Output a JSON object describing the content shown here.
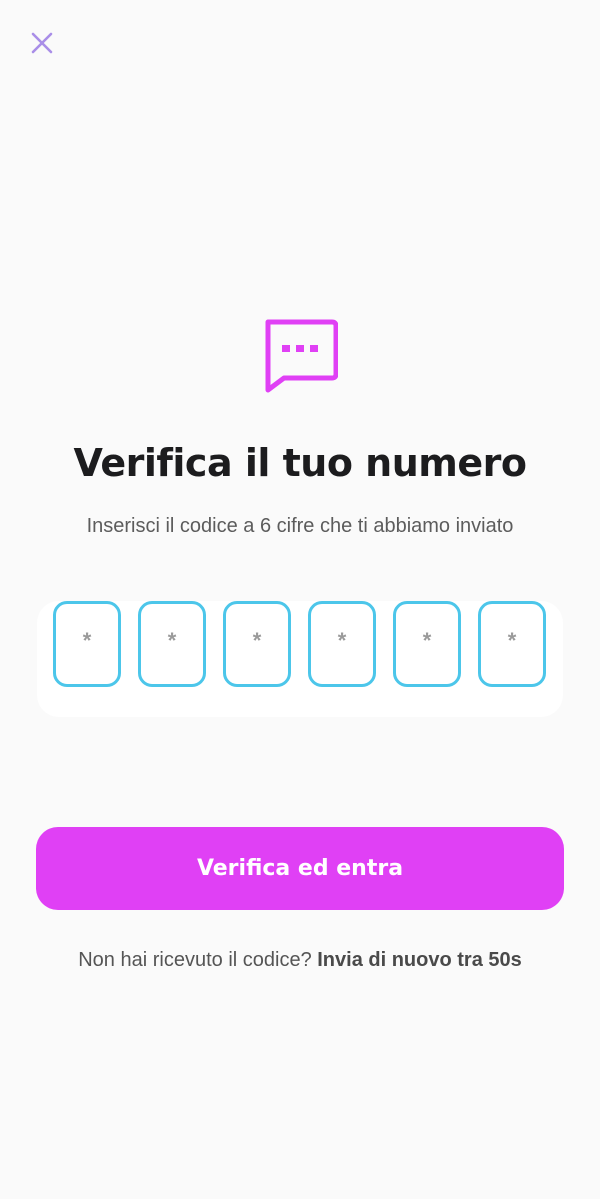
{
  "header": {
    "close_icon": "close-icon",
    "close_color": "#a98ee8"
  },
  "hero": {
    "icon": "message-dots-icon",
    "icon_color": "#e040f5"
  },
  "title": "Verifica il tuo numero",
  "subtitle": "Inserisci il codice a 6 cifre che ti abbiamo inviato",
  "code": {
    "length": 6,
    "placeholder": "*",
    "digits": [
      "*",
      "*",
      "*",
      "*",
      "*",
      "*"
    ],
    "border_color": "#4cc6ea"
  },
  "primary_button": {
    "label": "Verifica ed entra",
    "color": "#e040f5"
  },
  "resend": {
    "prompt": "Non hai ricevuto il codice?",
    "link_label": "Invia di nuovo tra 50s"
  }
}
